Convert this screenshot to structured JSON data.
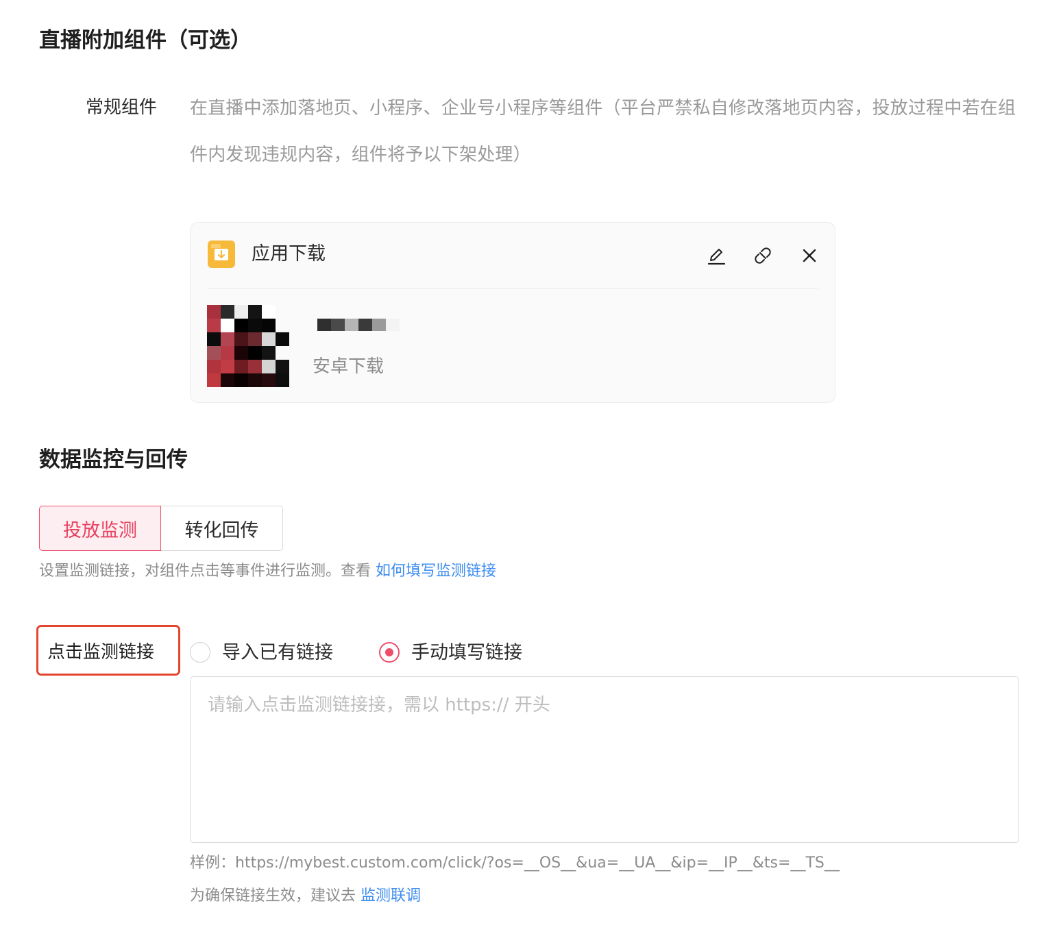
{
  "section1": {
    "title": "直播附加组件（可选）",
    "field_label": "常规组件",
    "description": "在直播中添加落地页、小程序、企业号小程序等组件（平台严禁私自修改落地页内容，投放过程中若在组件内发现违规内容，组件将予以下架处理）"
  },
  "card": {
    "title": "应用下载",
    "icon": "folder-download-icon",
    "actions": [
      "edit-icon",
      "link-icon",
      "close-icon"
    ],
    "app_subtitle": "安卓下载"
  },
  "section2": {
    "title": "数据监控与回传",
    "tabs": [
      {
        "label": "投放监测",
        "active": true
      },
      {
        "label": "转化回传",
        "active": false
      }
    ],
    "hint_text": "设置监测链接，对组件点击等事件进行监测。查看",
    "hint_link": "如何填写监测链接"
  },
  "click_monitor": {
    "label": "点击监测链接",
    "options": [
      {
        "label": "导入已有链接",
        "selected": false
      },
      {
        "label": "手动填写链接",
        "selected": true
      }
    ],
    "input_value": "",
    "placeholder": "请输入点击监测链接接，需以 https:// 开头",
    "example": "样例：https://mybest.custom.com/click/?os=__OS__&ua=__UA__&ip=__IP__&ts=__TS__",
    "tip_text": "为确保链接生效，建议去",
    "tip_link": "监测联调"
  },
  "colors": {
    "accent": "#ee4d6b",
    "link": "#3c8cf0",
    "highlight_box": "#e5452f",
    "folder_icon": "#f7b93a"
  }
}
